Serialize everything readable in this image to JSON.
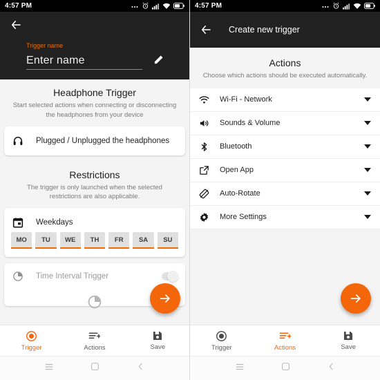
{
  "left": {
    "statusbar": {
      "time": "4:57 PM",
      "icons": [
        "more-dots",
        "alarm-icon",
        "signal-icon",
        "wifi-icon",
        "battery-icon"
      ]
    },
    "appbar": {
      "back_icon": "back-arrow-icon"
    },
    "trigger_name": {
      "label": "Trigger name",
      "value": "Enter name",
      "placeholder": "Enter name",
      "edit_icon": "pencil-icon"
    },
    "headphone": {
      "title": "Headphone Trigger",
      "subtitle": "Start selected actions when connecting or disconnecting the headphones from your device",
      "row_label": "Plugged / Unplugged the headphones",
      "row_icon": "headphones-icon"
    },
    "restrictions": {
      "title": "Restrictions",
      "subtitle": "The trigger is only launched when the selected restrictions are also applicable."
    },
    "weekdays": {
      "label": "Weekdays",
      "icon": "calendar-icon",
      "days": [
        "MO",
        "TU",
        "WE",
        "TH",
        "FR",
        "SA",
        "SU"
      ]
    },
    "time_interval": {
      "label": "Time Interval Trigger",
      "icon": "clock-half-icon"
    },
    "fab": {
      "icon": "arrow-right-icon"
    },
    "tabs": [
      {
        "label": "Trigger",
        "icon": "record-circle-icon",
        "active": true
      },
      {
        "label": "Actions",
        "icon": "list-plus-icon",
        "active": false
      },
      {
        "label": "Save",
        "icon": "floppy-disk-icon",
        "active": false
      }
    ]
  },
  "right": {
    "statusbar": {
      "time": "4:57 PM",
      "icons": [
        "more-dots",
        "alarm-icon",
        "signal-icon",
        "wifi-icon",
        "battery-icon"
      ]
    },
    "appbar": {
      "back_icon": "back-arrow-icon",
      "title": "Create new trigger"
    },
    "actions_header": {
      "title": "Actions",
      "subtitle": "Choose which actions should be executed automatically."
    },
    "actions": [
      {
        "label": "Wi-Fi - Network",
        "icon": "wifi-icon",
        "caret": "chevron-down-icon"
      },
      {
        "label": "Sounds & Volume",
        "icon": "speaker-icon",
        "caret": "chevron-down-icon"
      },
      {
        "label": "Bluetooth",
        "icon": "bluetooth-icon",
        "caret": "chevron-down-icon"
      },
      {
        "label": "Open App",
        "icon": "open-external-icon",
        "caret": "chevron-down-icon"
      },
      {
        "label": "Auto-Rotate",
        "icon": "auto-rotate-icon",
        "caret": "chevron-down-icon"
      },
      {
        "label": "More Settings",
        "icon": "gear-icon",
        "caret": "chevron-down-icon"
      }
    ],
    "fab": {
      "icon": "arrow-right-icon"
    },
    "tabs": [
      {
        "label": "Trigger",
        "icon": "record-circle-icon",
        "active": false
      },
      {
        "label": "Actions",
        "icon": "list-plus-icon",
        "active": true
      },
      {
        "label": "Save",
        "icon": "floppy-disk-icon",
        "active": false
      }
    ]
  },
  "sysnav": {
    "items": [
      "menu-icon",
      "home-square-icon",
      "back-chevron-icon"
    ]
  },
  "colors": {
    "accent": "#f4660a",
    "accent_text": "#ef6c00",
    "dark_bar": "#212121",
    "bg": "#f4f4f4"
  }
}
